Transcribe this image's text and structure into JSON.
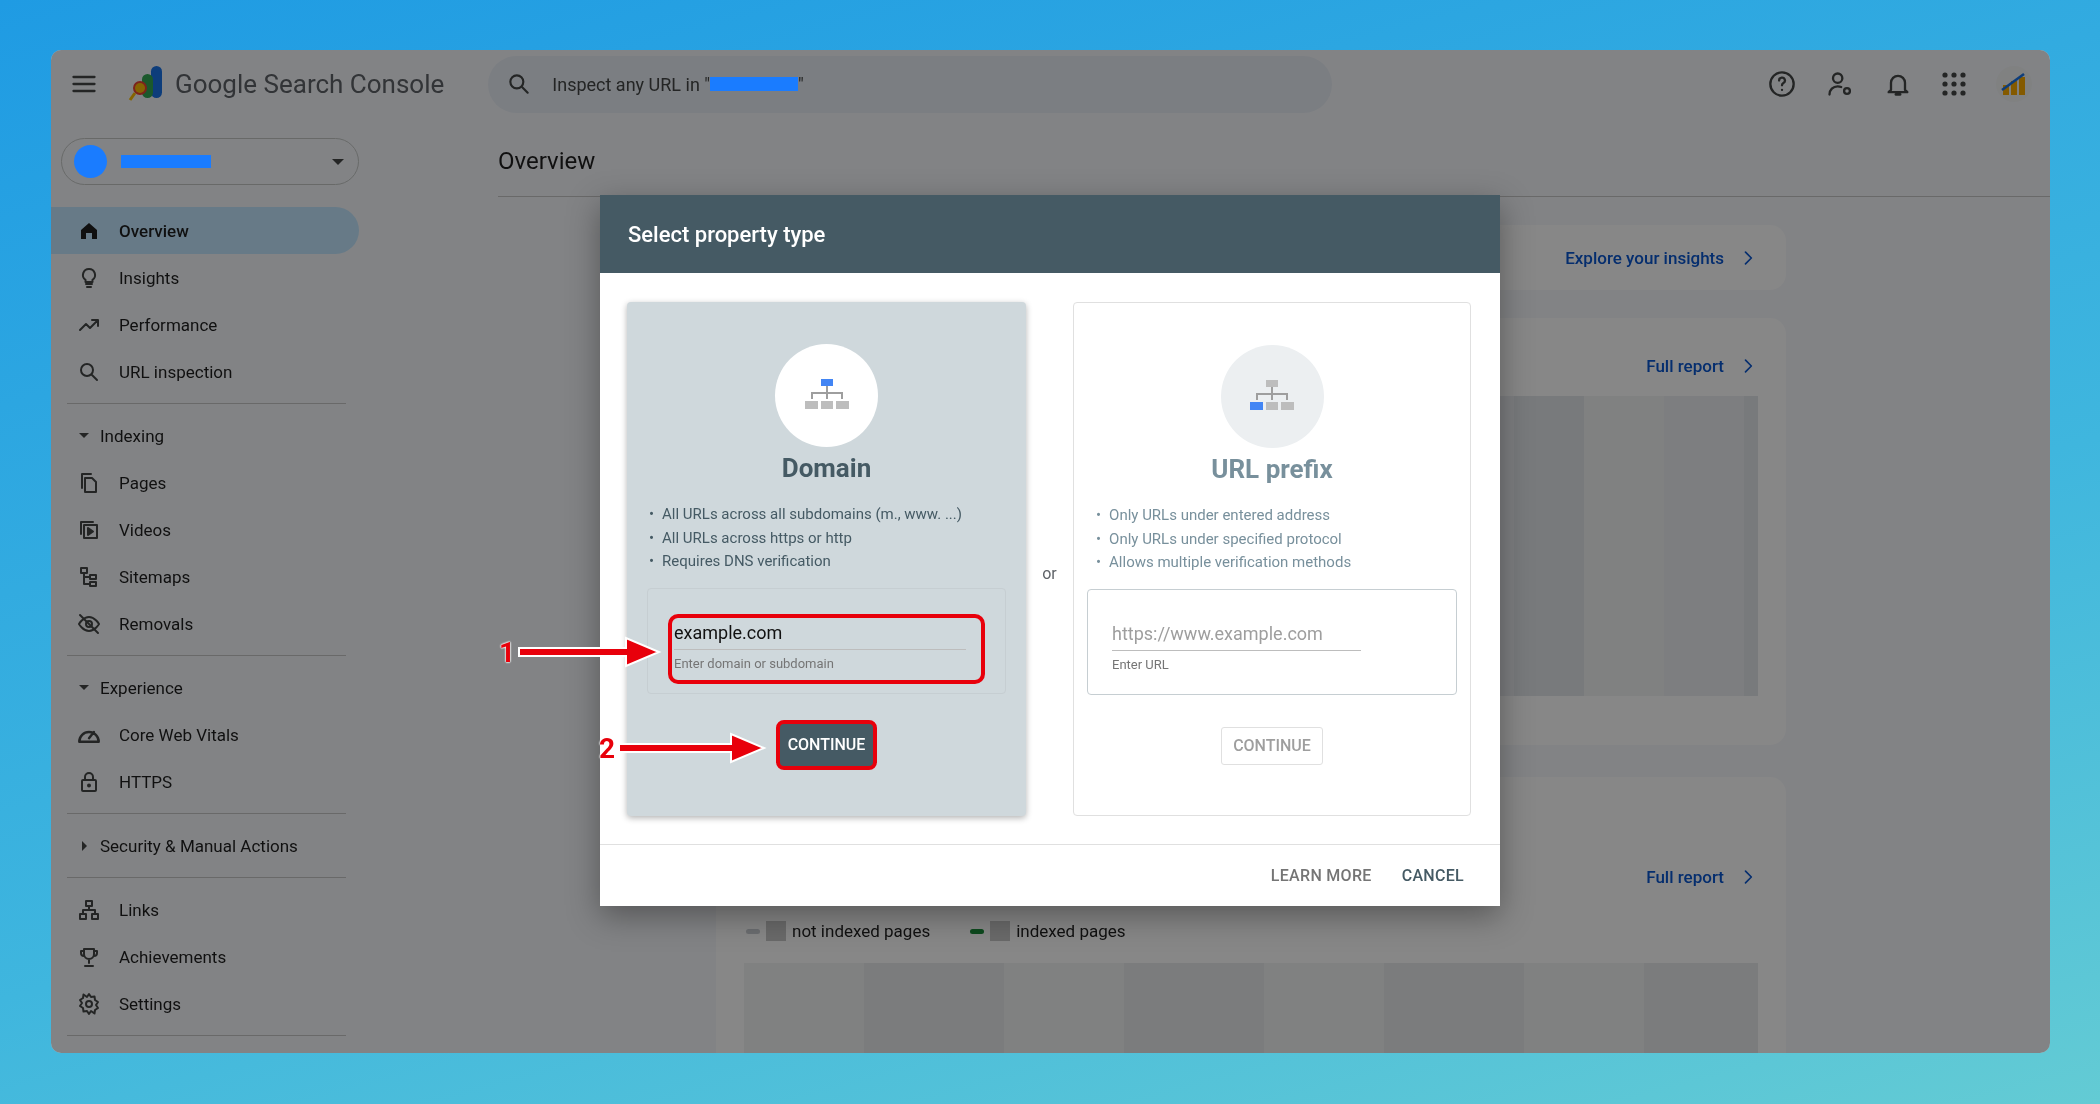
{
  "header": {
    "product": "Google Search Console",
    "search": {
      "prefix": "Inspect any URL in \"",
      "suffix": "\""
    }
  },
  "sidebar": {
    "groups": [
      {
        "items": [
          {
            "label": "Overview",
            "selected": true
          },
          {
            "label": "Insights",
            "selected": false
          },
          {
            "label": "Performance",
            "selected": false
          },
          {
            "label": "URL inspection",
            "selected": false
          }
        ]
      },
      {
        "section": {
          "label": "Indexing",
          "expanded": true
        },
        "items": [
          {
            "label": "Pages",
            "selected": false
          },
          {
            "label": "Videos",
            "selected": false
          },
          {
            "label": "Sitemaps",
            "selected": false
          },
          {
            "label": "Removals",
            "selected": false
          }
        ]
      },
      {
        "section": {
          "label": "Experience",
          "expanded": true
        },
        "items": [
          {
            "label": "Core Web Vitals",
            "selected": false
          },
          {
            "label": "HTTPS",
            "selected": false
          }
        ]
      },
      {
        "section": {
          "label": "Security & Manual Actions",
          "expanded": false
        }
      },
      {
        "items": [
          {
            "label": "Links",
            "selected": false
          },
          {
            "label": "Achievements",
            "selected": false
          },
          {
            "label": "Settings",
            "selected": false
          }
        ]
      }
    ]
  },
  "main": {
    "title": "Overview",
    "cards": [
      {
        "link": "Explore your insights"
      },
      {
        "link": "Full report"
      },
      {
        "link": "Full report",
        "legend": [
          {
            "label": "not indexed pages",
            "color": "#6b6d70"
          },
          {
            "label": "indexed pages",
            "color": "#0d4a1e"
          }
        ]
      }
    ]
  },
  "dialog": {
    "title": "Select property type",
    "separator": "or",
    "bullet_marker": "•",
    "options": [
      {
        "title": "Domain",
        "selected": true,
        "bullets": [
          "All URLs across all subdomains (m., www. ...)",
          "All URLs across https or http",
          "Requires DNS verification"
        ],
        "field": {
          "value": "example.com",
          "helper": "Enter domain or subdomain",
          "highlighted": true,
          "callout": "1"
        },
        "button": {
          "label": "CONTINUE",
          "disabled": false,
          "highlighted": true,
          "callout": "2"
        }
      },
      {
        "title": "URL prefix",
        "selected": false,
        "bullets": [
          "Only URLs under entered address",
          "Only URLs under specified protocol",
          "Allows multiple verification methods"
        ],
        "field": {
          "placeholder": "https://www.example.com",
          "helper": "Enter URL",
          "highlighted": false
        },
        "button": {
          "label": "CONTINUE",
          "disabled": true,
          "highlighted": false
        }
      }
    ],
    "actions": [
      {
        "label": "LEARN MORE",
        "kind": "secondary"
      },
      {
        "label": "CANCEL",
        "kind": "primary"
      }
    ]
  }
}
